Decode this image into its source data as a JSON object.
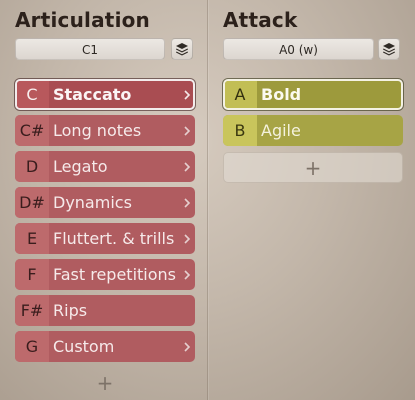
{
  "articulation": {
    "title": "Articulation",
    "selector_value": "C1",
    "items": [
      {
        "key": "C",
        "label": "Staccato",
        "selected": true,
        "chevron": true
      },
      {
        "key": "C#",
        "label": "Long notes",
        "selected": false,
        "chevron": true
      },
      {
        "key": "D",
        "label": "Legato",
        "selected": false,
        "chevron": true
      },
      {
        "key": "D#",
        "label": "Dynamics",
        "selected": false,
        "chevron": true
      },
      {
        "key": "E",
        "label": "Fluttert. & trills",
        "selected": false,
        "chevron": true
      },
      {
        "key": "F",
        "label": "Fast repetitions",
        "selected": false,
        "chevron": true
      },
      {
        "key": "F#",
        "label": "Rips",
        "selected": false,
        "chevron": false
      },
      {
        "key": "G",
        "label": "Custom",
        "selected": false,
        "chevron": true
      }
    ],
    "add_symbol": "+"
  },
  "attack": {
    "title": "Attack",
    "selector_value": "A0 (w)",
    "items": [
      {
        "key": "A",
        "label": "Bold",
        "selected": true
      },
      {
        "key": "B",
        "label": "Agile",
        "selected": false
      }
    ],
    "add_symbol": "+"
  },
  "icons": {
    "stack": "layers-icon",
    "chevron": "chevron-right-icon",
    "add": "plus-icon"
  },
  "colors": {
    "articulation_row": "#b05c60",
    "articulation_key": "#bd6a6c",
    "attack_row": "#a7a445",
    "attack_key": "#c9c55c"
  }
}
